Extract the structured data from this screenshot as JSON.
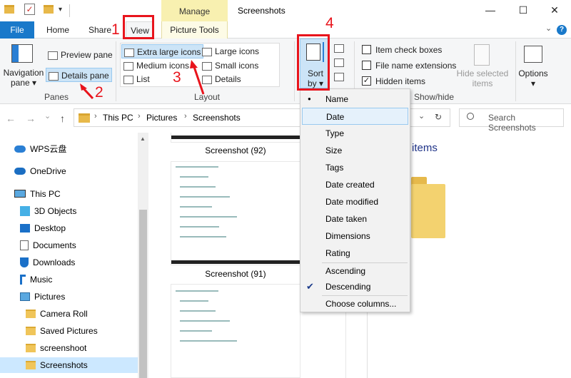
{
  "window": {
    "title": "Screenshots",
    "manage_tab": "Manage",
    "min": "—",
    "max": "☐",
    "close": "✕"
  },
  "quick_access": {
    "check": "✓",
    "arrow": "▾"
  },
  "tabs": {
    "file": "File",
    "home": "Home",
    "share": "Share",
    "view": "View",
    "picture_tools": "Picture Tools",
    "collapse": "⌄",
    "help": "?"
  },
  "ribbon": {
    "panes": {
      "label": "Panes",
      "navigation": "Navigation",
      "navigation2": "pane ▾",
      "preview": "Preview pane",
      "details": "Details pane"
    },
    "layout": {
      "label": "Layout",
      "extra_large": "Extra large icons",
      "large": "Large icons",
      "medium": "Medium icons",
      "small": "Small icons",
      "list": "List",
      "details": "Details"
    },
    "sort": {
      "label1": "Sort",
      "label2": "by ▾"
    },
    "show_hide": {
      "label": "Show/hide",
      "item_check": "Item check boxes",
      "file_ext": "File name extensions",
      "hidden": "Hidden items",
      "hidden_checked": "✓",
      "hide_selected1": "Hide selected",
      "hide_selected2": "items",
      "options": "Options",
      "options_arrow": "▾"
    }
  },
  "nav": {
    "back": "←",
    "forward": "→",
    "recent": "⌄",
    "up": "↑",
    "crumbs": [
      "This PC",
      "Pictures",
      "Screenshots"
    ],
    "crumb_sep": "›",
    "dropdown": "⌄",
    "refresh": "↻",
    "search_placeholder": "Search Screenshots"
  },
  "nav_pane": {
    "items": [
      {
        "label": "WPS云盘"
      },
      {
        "label": "OneDrive"
      },
      {
        "label": "This PC"
      },
      {
        "label": "3D Objects"
      },
      {
        "label": "Desktop"
      },
      {
        "label": "Documents"
      },
      {
        "label": "Downloads"
      },
      {
        "label": "Music"
      },
      {
        "label": "Pictures"
      },
      {
        "label": "Camera Roll"
      },
      {
        "label": "Saved Pictures"
      },
      {
        "label": "screenshoot"
      },
      {
        "label": "Screenshots"
      }
    ],
    "scroll_up": "▲"
  },
  "content": {
    "files": [
      {
        "label": "Screenshot (92)"
      },
      {
        "label": "Screenshot (91)"
      }
    ],
    "details_text": "items"
  },
  "sort_menu": {
    "items": [
      "Name",
      "Date",
      "Type",
      "Size",
      "Tags",
      "Date created",
      "Date modified",
      "Date taken",
      "Dimensions",
      "Rating"
    ],
    "order": [
      "Ascending",
      "Descending"
    ],
    "choose": "Choose columns...",
    "bullet": "●",
    "check": "✔"
  },
  "annotations": {
    "n1": "1",
    "n2": "2",
    "n3": "3",
    "n4": "4",
    "color": "#e8141c"
  }
}
